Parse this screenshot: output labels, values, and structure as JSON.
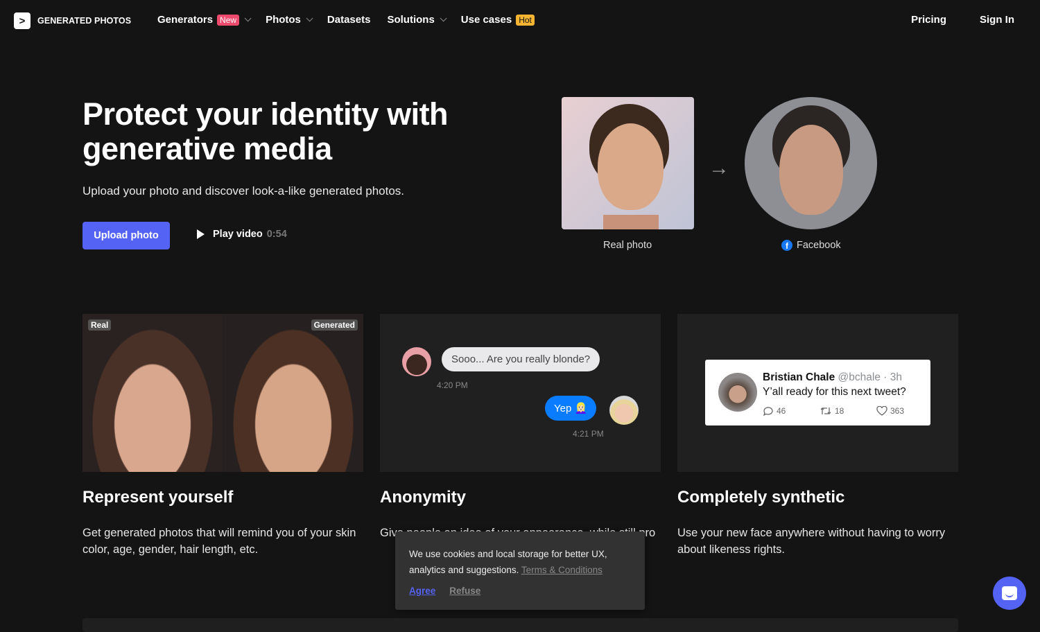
{
  "nav": {
    "logo_glyph": ">",
    "brand": "GENERATED PHOTOS",
    "items": [
      {
        "label": "Generators",
        "badge": "New",
        "dropdown": true
      },
      {
        "label": "Photos",
        "dropdown": true
      },
      {
        "label": "Datasets"
      },
      {
        "label": "Solutions",
        "dropdown": true
      },
      {
        "label": "Use cases",
        "badge": "Hot"
      }
    ],
    "pricing": "Pricing",
    "sign_in": "Sign In"
  },
  "hero": {
    "title": "Protect your identity with generative media",
    "subtitle": "Upload your photo and discover look-a-like generated photos.",
    "upload_label": "Upload photo",
    "play_label": "Play video",
    "play_duration": "0:54",
    "real_caption": "Real photo",
    "generated_caption": "Facebook",
    "arrow": "→"
  },
  "features": [
    {
      "title": "Represent yourself",
      "text": "Get generated photos that will remind you of your skin color, age, gender, hair length, etc.",
      "tags": [
        "Real",
        "Generated"
      ]
    },
    {
      "title": "Anonymity",
      "text": "Give people an idea of your appearance, while still pro",
      "chat": {
        "message1": "Sooo... Are you really blonde?",
        "time1": "4:20 PM",
        "message2": "Yep 👱🏻‍♀️",
        "time2": "4:21 PM"
      }
    },
    {
      "title": "Completely synthetic",
      "text": "Use your new face anywhere without having to worry about likeness rights.",
      "tweet": {
        "name": "Bristian Chale",
        "handle": "@bchale · 3h",
        "text": "Y’all ready for this next tweet?",
        "replies": "46",
        "retweets": "18",
        "likes": "363"
      }
    }
  ],
  "cookie": {
    "text": "We use cookies and local storage for better UX, analytics and suggestions.",
    "terms": "Terms & Conditions",
    "agree": "Agree",
    "refuse": "Refuse"
  },
  "colors": {
    "accent": "#5563f5",
    "new_badge": "#ee4a6d",
    "hot_badge": "#f5b533",
    "background": "#141414"
  }
}
